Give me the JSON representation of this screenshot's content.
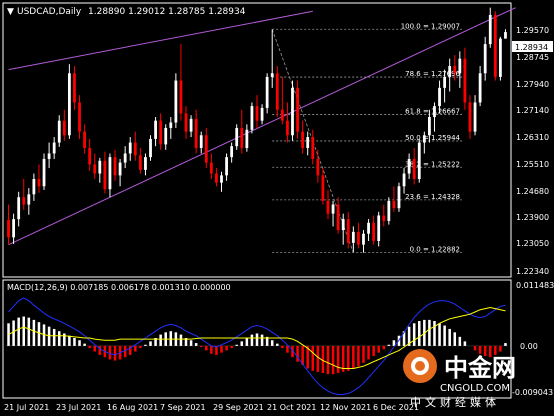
{
  "header": {
    "symbol_label": "USDCAD,Daily",
    "ohlc_label": "1.28890 1.29012 1.28785 1.28934"
  },
  "macd_label": "MACD(12,26,9) 0.007185 0.006178 0.001310 0.000000",
  "price_axis": [
    "1.29570",
    "1.27940",
    "1.26310",
    "1.24680",
    "1.23050"
  ],
  "price_axis_small": [
    "1.28745",
    "1.27140",
    "1.25510",
    "1.23900",
    "1.22340"
  ],
  "current_price": "1.28934",
  "macd_axis": [
    "0.011483",
    "0.00",
    "-0.009043"
  ],
  "time_axis": [
    "21 Jul 2021",
    "23 Jul 2021",
    "16 Aug 2021",
    "7 Sep 2021",
    "29 Sep 2021",
    "21 Oct 2021",
    "12 Nov 2021",
    "6 Dec 2021"
  ],
  "fib_levels": [
    {
      "label": "100.0 = 1.29007",
      "price": 1.29007
    },
    {
      "label": "78.6 = 1.27696",
      "price": 1.27696
    },
    {
      "label": "61.8 = 1.26667",
      "price": 1.26667
    },
    {
      "label": "50.0 = 1.25944",
      "price": 1.25944
    },
    {
      "label": "38.2 = 1.25222",
      "price": 1.25222
    },
    {
      "label": "23.6 = 1.24328",
      "price": 1.24328
    },
    {
      "label": "0.0 = 1.22882",
      "price": 1.22882
    }
  ],
  "watermark": {
    "brand": "中金网",
    "site": "CNGOLD.COM",
    "slogan": "中文财经媒体"
  },
  "colors": {
    "background": "#000000",
    "bull_candle": "#ffffff",
    "bear_candle": "#ff0000",
    "channel": "#b25ad8",
    "fib": "#9a9a9a",
    "macd_hist_pos": "#ffffff",
    "macd_hist_neg": "#ff0000",
    "macd_line": "#2030ff",
    "signal_line": "#ffff00"
  },
  "chart_data": {
    "type": "candlestick",
    "symbol": "USDCAD",
    "timeframe": "Daily",
    "ylim": [
      1.2224,
      1.297
    ],
    "candles": [
      [
        1.2378,
        1.242,
        1.231,
        1.233
      ],
      [
        1.233,
        1.2395,
        1.2312,
        1.238
      ],
      [
        1.238,
        1.2455,
        1.236,
        1.244
      ],
      [
        1.244,
        1.249,
        1.2405,
        1.242
      ],
      [
        1.242,
        1.2465,
        1.2392,
        1.2448
      ],
      [
        1.2448,
        1.2505,
        1.243,
        1.249
      ],
      [
        1.249,
        1.253,
        1.2452,
        1.247
      ],
      [
        1.247,
        1.256,
        1.246,
        1.2545
      ],
      [
        1.2545,
        1.259,
        1.252,
        1.256
      ],
      [
        1.256,
        1.2605,
        1.2545,
        1.259
      ],
      [
        1.259,
        1.2665,
        1.2578,
        1.265
      ],
      [
        1.265,
        1.268,
        1.2595,
        1.261
      ],
      [
        1.261,
        1.2805,
        1.26,
        1.278
      ],
      [
        1.278,
        1.28,
        1.268,
        1.27
      ],
      [
        1.27,
        1.272,
        1.26,
        1.262
      ],
      [
        1.262,
        1.264,
        1.256,
        1.2575
      ],
      [
        1.2575,
        1.26,
        1.2512,
        1.253
      ],
      [
        1.253,
        1.256,
        1.249,
        1.2505
      ],
      [
        1.2505,
        1.2548,
        1.248,
        1.254
      ],
      [
        1.254,
        1.2565,
        1.245,
        1.2462
      ],
      [
        1.2462,
        1.256,
        1.244,
        1.255
      ],
      [
        1.255,
        1.257,
        1.2485,
        1.25
      ],
      [
        1.25,
        1.2545,
        1.247,
        1.2535
      ],
      [
        1.2535,
        1.258,
        1.252,
        1.256
      ],
      [
        1.256,
        1.2605,
        1.254,
        1.259
      ],
      [
        1.259,
        1.262,
        1.254,
        1.2555
      ],
      [
        1.2555,
        1.2575,
        1.2505,
        1.2515
      ],
      [
        1.2515,
        1.256,
        1.25,
        1.255
      ],
      [
        1.255,
        1.261,
        1.254,
        1.26
      ],
      [
        1.26,
        1.266,
        1.258,
        1.265
      ],
      [
        1.265,
        1.267,
        1.257,
        1.2585
      ],
      [
        1.2585,
        1.264,
        1.257,
        1.263
      ],
      [
        1.263,
        1.266,
        1.26,
        1.2645
      ],
      [
        1.2645,
        1.278,
        1.263,
        1.276
      ],
      [
        1.276,
        1.286,
        1.265,
        1.267
      ],
      [
        1.267,
        1.269,
        1.26,
        1.262
      ],
      [
        1.262,
        1.2665,
        1.2605,
        1.2655
      ],
      [
        1.2655,
        1.268,
        1.256,
        1.2575
      ],
      [
        1.2575,
        1.262,
        1.256,
        1.261
      ],
      [
        1.261,
        1.263,
        1.252,
        1.2535
      ],
      [
        1.2535,
        1.256,
        1.249,
        1.2505
      ],
      [
        1.2505,
        1.252,
        1.247,
        1.248
      ],
      [
        1.248,
        1.251,
        1.2455,
        1.25
      ],
      [
        1.25,
        1.256,
        1.2485,
        1.255
      ],
      [
        1.255,
        1.259,
        1.2535,
        1.258
      ],
      [
        1.258,
        1.264,
        1.257,
        1.263
      ],
      [
        1.263,
        1.268,
        1.256,
        1.2575
      ],
      [
        1.2575,
        1.264,
        1.2565,
        1.2625
      ],
      [
        1.2625,
        1.27,
        1.2615,
        1.269
      ],
      [
        1.269,
        1.272,
        1.263,
        1.265
      ],
      [
        1.265,
        1.2695,
        1.264,
        1.2685
      ],
      [
        1.2685,
        1.278,
        1.267,
        1.277
      ],
      [
        1.277,
        1.29,
        1.274,
        1.278
      ],
      [
        1.278,
        1.28,
        1.266,
        1.268
      ],
      [
        1.268,
        1.277,
        1.264,
        1.265
      ],
      [
        1.265,
        1.27,
        1.259,
        1.261
      ],
      [
        1.261,
        1.276,
        1.2595,
        1.274
      ],
      [
        1.274,
        1.276,
        1.26,
        1.262
      ],
      [
        1.262,
        1.265,
        1.256,
        1.2575
      ],
      [
        1.2575,
        1.262,
        1.2555,
        1.2605
      ],
      [
        1.2605,
        1.2625,
        1.253,
        1.2545
      ],
      [
        1.2545,
        1.257,
        1.248,
        1.25
      ],
      [
        1.25,
        1.252,
        1.242,
        1.243
      ],
      [
        1.243,
        1.246,
        1.238,
        1.2395
      ],
      [
        1.2395,
        1.243,
        1.236,
        1.242
      ],
      [
        1.242,
        1.244,
        1.234,
        1.235
      ],
      [
        1.235,
        1.2395,
        1.231,
        1.238
      ],
      [
        1.238,
        1.24,
        1.23,
        1.2315
      ],
      [
        1.2315,
        1.236,
        1.229,
        1.2345
      ],
      [
        1.2345,
        1.237,
        1.23,
        1.231
      ],
      [
        1.231,
        1.235,
        1.2288,
        1.234
      ],
      [
        1.234,
        1.238,
        1.232,
        1.237
      ],
      [
        1.237,
        1.239,
        1.231,
        1.232
      ],
      [
        1.232,
        1.24,
        1.2305,
        1.239
      ],
      [
        1.239,
        1.242,
        1.236,
        1.2375
      ],
      [
        1.2375,
        1.244,
        1.2365,
        1.243
      ],
      [
        1.243,
        1.247,
        1.24,
        1.241
      ],
      [
        1.241,
        1.248,
        1.24,
        1.247
      ],
      [
        1.247,
        1.252,
        1.245,
        1.2505
      ],
      [
        1.2505,
        1.256,
        1.249,
        1.2545
      ],
      [
        1.2545,
        1.2575,
        1.2475,
        1.249
      ],
      [
        1.249,
        1.26,
        1.248,
        1.259
      ],
      [
        1.259,
        1.262,
        1.256,
        1.261
      ],
      [
        1.261,
        1.268,
        1.259,
        1.266
      ],
      [
        1.266,
        1.27,
        1.262,
        1.269
      ],
      [
        1.269,
        1.276,
        1.267,
        1.274
      ],
      [
        1.274,
        1.279,
        1.27,
        1.277
      ],
      [
        1.277,
        1.282,
        1.273,
        1.28
      ],
      [
        1.28,
        1.283,
        1.276,
        1.278
      ],
      [
        1.278,
        1.284,
        1.274,
        1.282
      ],
      [
        1.282,
        1.285,
        1.268,
        1.27
      ],
      [
        1.27,
        1.272,
        1.26,
        1.262
      ],
      [
        1.262,
        1.272,
        1.261,
        1.27
      ],
      [
        1.27,
        1.28,
        1.269,
        1.278
      ],
      [
        1.278,
        1.288,
        1.276,
        1.286
      ],
      [
        1.286,
        1.296,
        1.285,
        1.294
      ],
      [
        1.294,
        1.295,
        1.276,
        1.277
      ],
      [
        1.277,
        1.288,
        1.276,
        1.2875
      ],
      [
        1.2875,
        1.2901,
        1.2878,
        1.2893
      ]
    ],
    "macd_histogram": [
      0.004,
      0.0045,
      0.005,
      0.0052,
      0.005,
      0.0046,
      0.0042,
      0.0038,
      0.0034,
      0.003,
      0.0026,
      0.0022,
      0.0018,
      0.0014,
      0.001,
      0.0004,
      -0.0004,
      -0.001,
      -0.0016,
      -0.002,
      -0.0024,
      -0.0026,
      -0.0024,
      -0.002,
      -0.0016,
      -0.001,
      -0.0004,
      0.0002,
      0.0008,
      0.0014,
      0.002,
      0.0024,
      0.0026,
      0.0024,
      0.002,
      0.0014,
      0.001,
      0.0005,
      -0.0002,
      -0.0008,
      -0.0014,
      -0.0016,
      -0.0012,
      -0.0008,
      -0.0004,
      0.0002,
      0.0008,
      0.0014,
      0.002,
      0.0022,
      0.002,
      0.0016,
      0.001,
      0.0004,
      -0.0004,
      -0.0012,
      -0.002,
      -0.0028,
      -0.0034,
      -0.004,
      -0.0044,
      -0.0046,
      -0.0048,
      -0.005,
      -0.005,
      -0.0048,
      -0.0046,
      -0.0044,
      -0.004,
      -0.0036,
      -0.003,
      -0.0024,
      -0.0018,
      -0.0012,
      -0.0006,
      0.0002,
      0.001,
      0.0018,
      0.0026,
      0.0034,
      0.004,
      0.0044,
      0.0046,
      0.0046,
      0.0044,
      0.004,
      0.0036,
      0.003,
      0.0024,
      0.0016,
      0.0008,
      0.0,
      -0.0008,
      -0.0014,
      -0.0018,
      -0.002,
      -0.0016,
      -0.001,
      0.0005
    ],
    "macd_line": [
      0.006,
      0.007,
      0.008,
      0.0085,
      0.008,
      0.0072,
      0.0065,
      0.0058,
      0.0052,
      0.0048,
      0.0044,
      0.004,
      0.0035,
      0.003,
      0.0025,
      0.0018,
      0.001,
      0.0002,
      -0.0005,
      -0.001,
      -0.0014,
      -0.0016,
      -0.0012,
      -0.0008,
      -0.0004,
      0.0002,
      0.0008,
      0.0014,
      0.002,
      0.0026,
      0.0032,
      0.0036,
      0.0038,
      0.0036,
      0.0032,
      0.0026,
      0.0022,
      0.0018,
      0.0012,
      0.0006,
      0.0,
      -0.0002,
      0.0002,
      0.0006,
      0.001,
      0.0016,
      0.0022,
      0.0028,
      0.0034,
      0.0036,
      0.0034,
      0.003,
      0.0024,
      0.0018,
      0.001,
      0.0002,
      -0.0008,
      -0.002,
      -0.0032,
      -0.0044,
      -0.0056,
      -0.0066,
      -0.0074,
      -0.008,
      -0.0084,
      -0.0086,
      -0.0086,
      -0.0084,
      -0.008,
      -0.0074,
      -0.0066,
      -0.0056,
      -0.0046,
      -0.0036,
      -0.0026,
      -0.0014,
      -0.0002,
      0.001,
      0.0024,
      0.0038,
      0.005,
      0.006,
      0.0068,
      0.0074,
      0.0078,
      0.008,
      0.008,
      0.0078,
      0.0074,
      0.0068,
      0.0062,
      0.0056,
      0.0052,
      0.005,
      0.0052,
      0.0058,
      0.0064,
      0.007,
      0.0072
    ],
    "signal_line": [
      0.002,
      0.0025,
      0.003,
      0.0033,
      0.003,
      0.0026,
      0.0023,
      0.002,
      0.0018,
      0.0018,
      0.0018,
      0.0018,
      0.0017,
      0.0016,
      0.0015,
      0.0014,
      0.0014,
      0.0012,
      0.0011,
      0.001,
      0.001,
      0.001,
      0.0012,
      0.0012,
      0.0012,
      0.0012,
      0.0012,
      0.0012,
      0.0012,
      0.0012,
      0.0012,
      0.0012,
      0.0012,
      0.0012,
      0.0012,
      0.0012,
      0.0012,
      0.0013,
      0.0014,
      0.0014,
      0.0014,
      0.0014,
      0.0014,
      0.0014,
      0.0014,
      0.0014,
      0.0014,
      0.0014,
      0.0014,
      0.0014,
      0.0014,
      0.0014,
      0.0014,
      0.0014,
      0.0014,
      0.0014,
      0.0012,
      0.0008,
      0.0002,
      -0.0004,
      -0.0012,
      -0.002,
      -0.0026,
      -0.003,
      -0.0034,
      -0.0038,
      -0.004,
      -0.004,
      -0.004,
      -0.0038,
      -0.0036,
      -0.0032,
      -0.0028,
      -0.0024,
      -0.002,
      -0.0016,
      -0.0012,
      -0.0008,
      -0.0002,
      0.0004,
      0.001,
      0.0016,
      0.0022,
      0.003,
      0.0034,
      0.004,
      0.0044,
      0.0048,
      0.005,
      0.0052,
      0.0054,
      0.0056,
      0.006,
      0.0064,
      0.0066,
      0.0068,
      0.0066,
      0.0064,
      0.0062
    ],
    "macd_ylim": [
      -0.009043,
      0.011483
    ],
    "channel_lines": [
      {
        "from": [
          0,
          1.279
        ],
        "to": [
          60,
          1.295
        ]
      },
      {
        "from": [
          0,
          1.231
        ],
        "to": [
          100,
          1.296
        ]
      }
    ],
    "fib_retracement": {
      "from": [
        52,
        1.29
      ],
      "to": [
        68,
        1.2288
      ]
    }
  }
}
